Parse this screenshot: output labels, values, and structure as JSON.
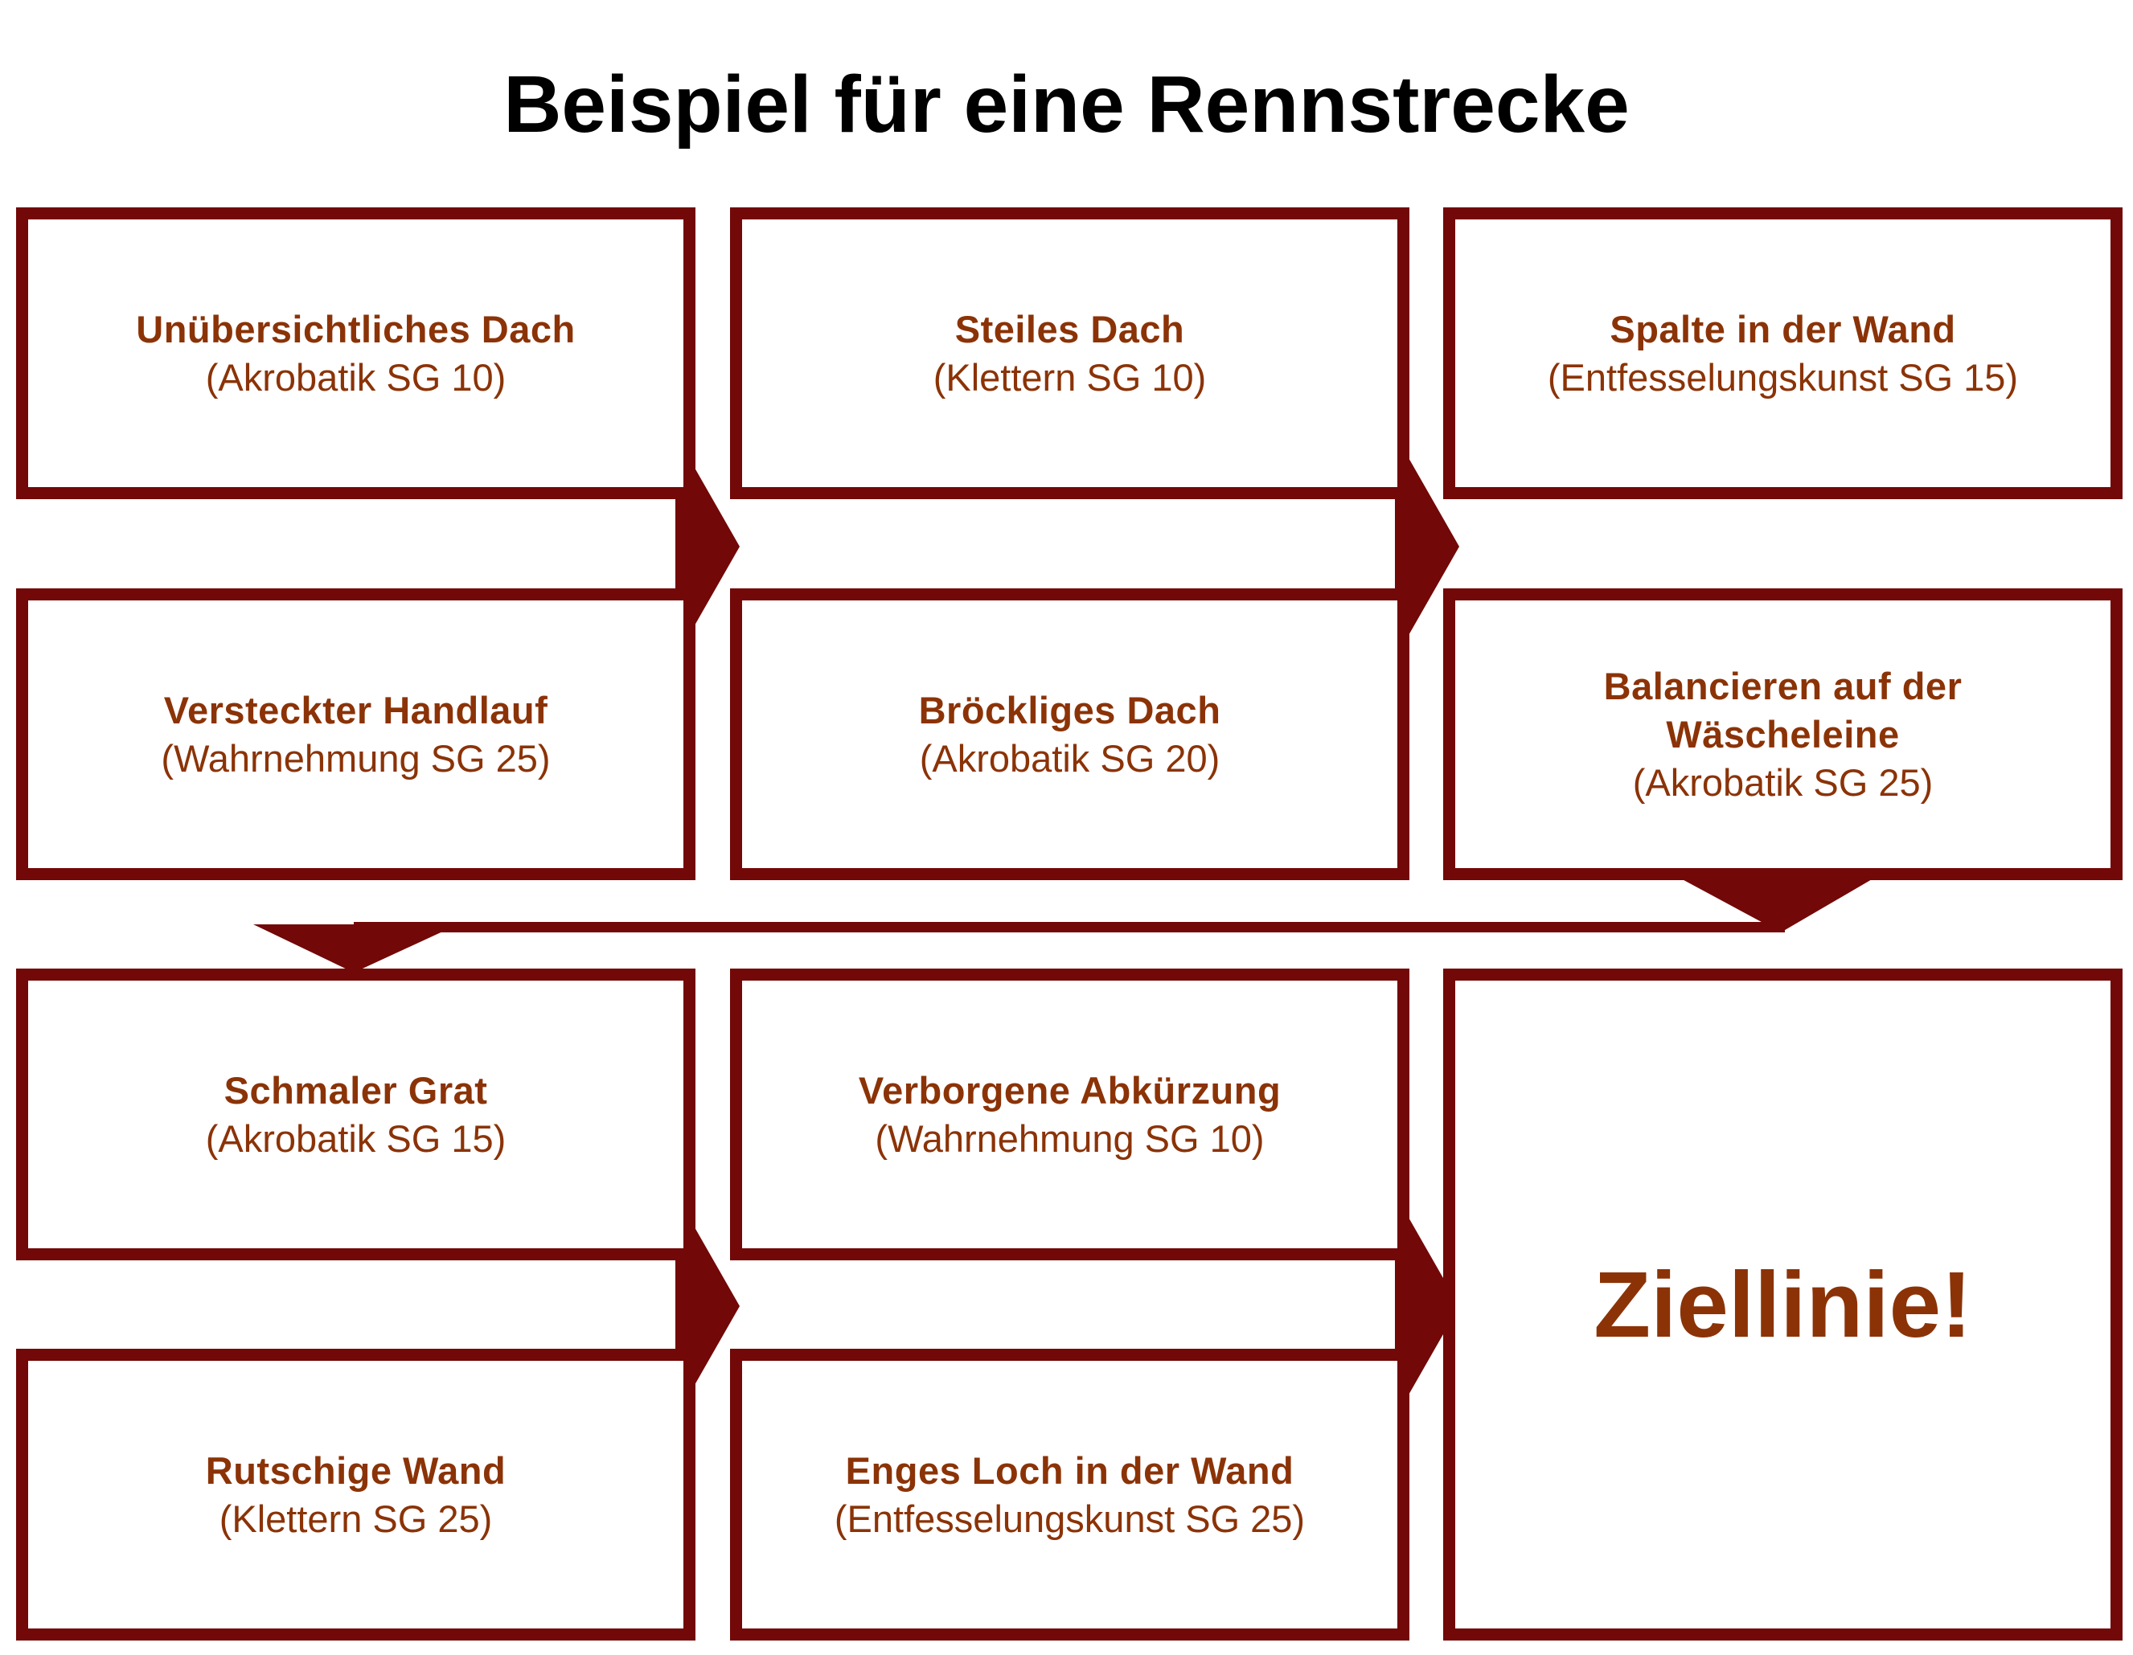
{
  "title": "Beispiel für eine Rennstrecke",
  "colors": {
    "border": "#720807",
    "text": "#8B3307",
    "title": "#000000"
  },
  "boxes": [
    {
      "name": "Unübersichtliches Dach",
      "check": "(Akrobatik SG 10)"
    },
    {
      "name": "Versteckter Handlauf",
      "check": "(Wahrnehmung SG 25)"
    },
    {
      "name": "Steiles Dach",
      "check": "(Klettern SG 10)"
    },
    {
      "name": "Bröckliges Dach",
      "check": "(Akrobatik SG 20)"
    },
    {
      "name": "Spalte in der Wand",
      "check": "(Entfesselungskunst SG 15)"
    },
    {
      "name": "Balancieren auf der Wäscheleine",
      "check": "(Akrobatik SG 25)"
    },
    {
      "name": "Schmaler Grat",
      "check": "(Akrobatik SG 15)"
    },
    {
      "name": "Rutschige Wand",
      "check": "(Klettern SG 25)"
    },
    {
      "name": "Verborgene Abkürzung",
      "check": "(Wahrnehmung SG 10)"
    },
    {
      "name": "Enges Loch in der Wand",
      "check": "(Entfesselungskunst SG 25)"
    }
  ],
  "finish": "Ziellinie!"
}
